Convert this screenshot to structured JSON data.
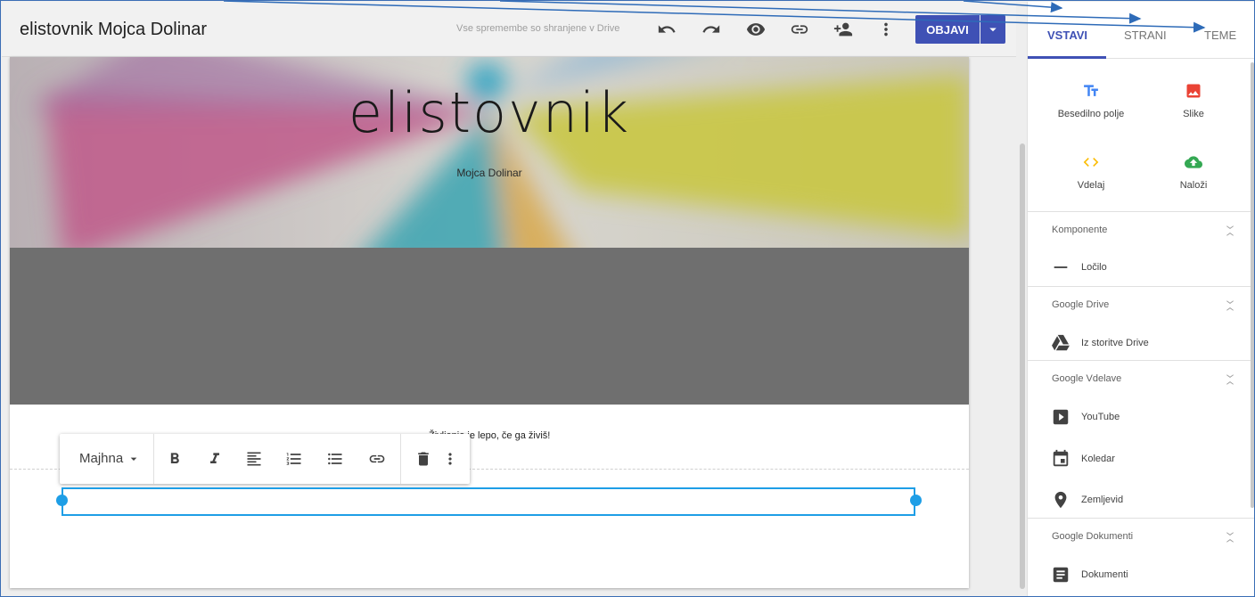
{
  "topbar": {
    "site_title": "elistovnik Mojca Dolinar",
    "save_status": "Vse spremembe so shranjene v Drive",
    "publish_label": "OBJAVI",
    "icons": [
      "undo-icon",
      "redo-icon",
      "preview-icon",
      "link-icon",
      "share-icon",
      "more-icon",
      "dropdown-icon"
    ]
  },
  "canvas": {
    "hero_title": "elistovnik",
    "hero_subtitle": "Mojca Dolinar",
    "quote": "Življenje je lepo, če ga živiš!",
    "text_toolbar": {
      "size_label": "Majhna",
      "icons": [
        "bold-icon",
        "italic-icon",
        "align-left-icon",
        "numbered-list-icon",
        "bulleted-list-icon",
        "link-icon",
        "delete-icon",
        "more-icon"
      ]
    }
  },
  "panel": {
    "tabs": [
      {
        "label": "VSTAVI",
        "active": true
      },
      {
        "label": "STRANI",
        "active": false
      },
      {
        "label": "TEME",
        "active": false
      }
    ],
    "insert_items": [
      {
        "label": "Besedilno polje",
        "icon": "text-box-icon",
        "color": "#4285f4"
      },
      {
        "label": "Slike",
        "icon": "image-icon",
        "color": "#ea4335"
      },
      {
        "label": "Vdelaj",
        "icon": "embed-icon",
        "color": "#fbbc04"
      },
      {
        "label": "Naloži",
        "icon": "upload-icon",
        "color": "#34a853"
      }
    ],
    "sections": [
      {
        "title": "Komponente",
        "items": [
          {
            "label": "Ločilo",
            "icon": "divider-icon"
          }
        ]
      },
      {
        "title": "Google Drive",
        "items": [
          {
            "label": "Iz storitve Drive",
            "icon": "drive-icon"
          }
        ]
      },
      {
        "title": "Google Vdelave",
        "items": [
          {
            "label": "YouTube",
            "icon": "youtube-icon"
          },
          {
            "label": "Koledar",
            "icon": "calendar-icon"
          },
          {
            "label": "Zemljevid",
            "icon": "map-pin-icon"
          }
        ]
      },
      {
        "title": "Google Dokumenti",
        "items": [
          {
            "label": "Dokumenti",
            "icon": "docs-icon"
          }
        ]
      }
    ]
  },
  "colors": {
    "accent": "#3f51b5",
    "selection": "#1e9ee6",
    "annotation_arrow": "#2e6bb8"
  }
}
